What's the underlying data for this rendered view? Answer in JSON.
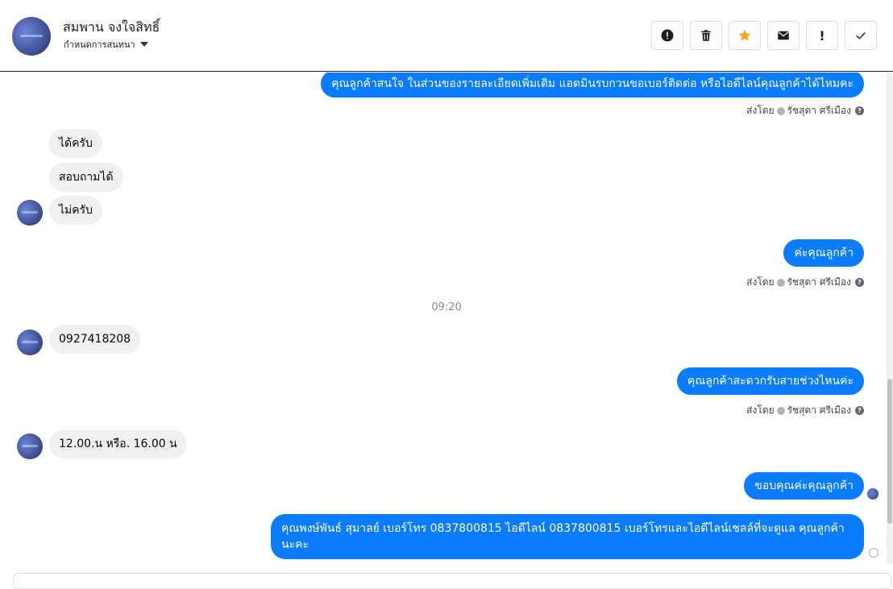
{
  "header": {
    "contact_name": "สมพาน จงใจสิทธิ์",
    "status_label": "กำหนดการสนทนา",
    "actions": [
      {
        "name": "report-icon"
      },
      {
        "name": "trash-icon"
      },
      {
        "name": "star-icon",
        "color": "#f5a623"
      },
      {
        "name": "mail-icon"
      },
      {
        "name": "exclamation-icon",
        "label": "!"
      },
      {
        "name": "check-icon"
      }
    ]
  },
  "thread": {
    "messages": [
      {
        "text": "คุณลูกค้าสนใจ ในส่วนของรายละเอียดเพิ่มเติม แอดมินรบกวนขอเบอร์ติดต่อ หรือไอดีไลน์คุณลูกค้าได้ไหมคะ"
      },
      {
        "text": "ได้ครับ"
      },
      {
        "text": "สอบถามได้"
      },
      {
        "text": "ไม่ครับ"
      },
      {
        "text": "ค่ะคุณลูกค้า"
      },
      {
        "text": "0927418208"
      },
      {
        "text": "คุณลูกค้าสะดวกรับสายช่วงไหนค่ะ"
      },
      {
        "text": "12.00.น หรือ. 16.00 น"
      },
      {
        "text": "ขอบคุณค่ะคุณลูกค้า"
      },
      {
        "text": "คุณพงษ์พันธ์ สุมาลย์      เบอร์โทร 0837800815  ไอดีไลน์ 0837800815   เบอร์โทรและไอดีไลน์เชลล์ที่จะดูแล คุณลูกค้านะคะ"
      }
    ],
    "sent_by_label": "ส่งโดย",
    "sender_name": "รัชสุดา ศรีเมือง",
    "timestamp": "09:20"
  },
  "colors": {
    "outgoing_bubble": "#0a7cff",
    "incoming_bubble": "#f0f0f0"
  }
}
